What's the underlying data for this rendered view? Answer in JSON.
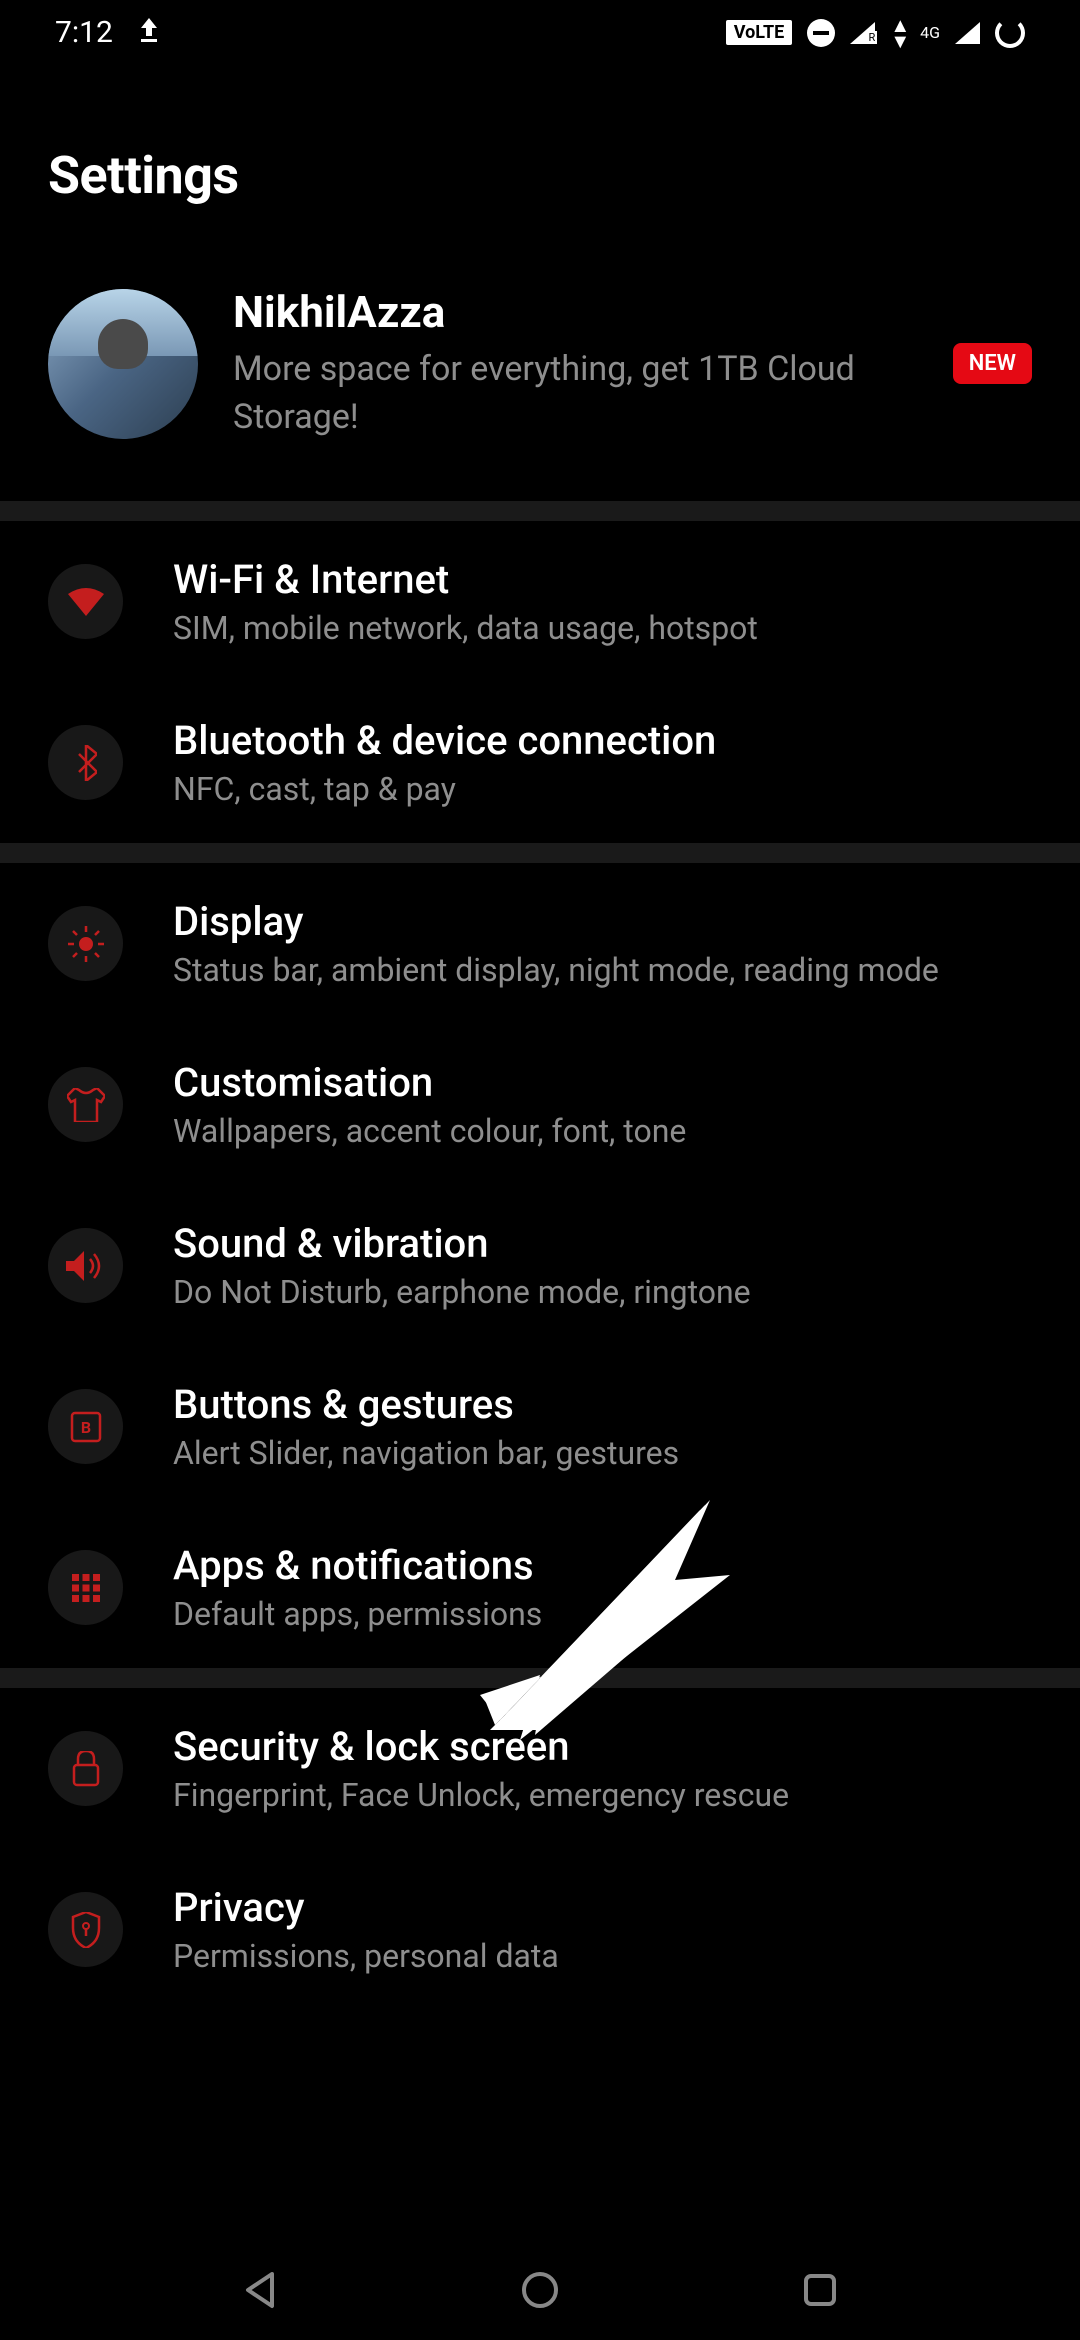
{
  "statusBar": {
    "time": "7:12",
    "volte": "VoLTE",
    "signal2": "4G"
  },
  "header": {
    "title": "Settings"
  },
  "profile": {
    "name": "NikhilAzza",
    "subtitle": "More space for everything, get 1TB Cloud Storage!",
    "badge": "NEW"
  },
  "items": [
    {
      "title": "Wi-Fi & Internet",
      "subtitle": "SIM, mobile network, data usage, hotspot",
      "icon": "wifi-icon"
    },
    {
      "title": "Bluetooth & device connection",
      "subtitle": "NFC, cast, tap & pay",
      "icon": "bluetooth-icon"
    },
    {
      "title": "Display",
      "subtitle": "Status bar, ambient display, night mode, reading mode",
      "icon": "brightness-icon"
    },
    {
      "title": "Customisation",
      "subtitle": "Wallpapers, accent colour, font, tone",
      "icon": "shirt-icon"
    },
    {
      "title": "Sound & vibration",
      "subtitle": "Do Not Disturb, earphone mode, ringtone",
      "icon": "volume-icon"
    },
    {
      "title": "Buttons & gestures",
      "subtitle": "Alert Slider, navigation bar, gestures",
      "icon": "button-icon"
    },
    {
      "title": "Apps & notifications",
      "subtitle": "Default apps, permissions",
      "icon": "apps-icon"
    },
    {
      "title": "Security & lock screen",
      "subtitle": "Fingerprint, Face Unlock, emergency rescue",
      "icon": "lock-icon"
    },
    {
      "title": "Privacy",
      "subtitle": "Permissions, personal data",
      "icon": "shield-icon"
    }
  ]
}
